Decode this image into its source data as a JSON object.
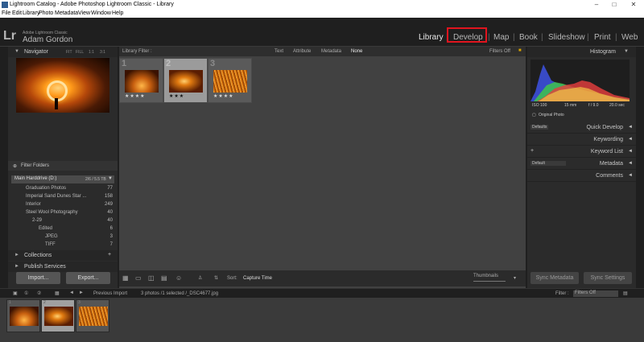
{
  "window": {
    "title": "Lightroom Catalog - Adobe Photoshop Lightroom Classic - Library",
    "minimize": "–",
    "restore": "□",
    "close": "✕"
  },
  "menu": [
    "File",
    "Edit",
    "Library",
    "Photo",
    "Metadata",
    "View",
    "Window",
    "Help"
  ],
  "identity": {
    "logo": "Lr",
    "product": "Adobe Lightroom Classic",
    "user": "Adam Gordon"
  },
  "modules": {
    "library": "Library",
    "develop": "Develop",
    "map": "Map",
    "book": "Book",
    "slideshow": "Slideshow",
    "print": "Print",
    "web": "Web",
    "sep": "|"
  },
  "navigator": {
    "title": "Navigator",
    "zoom": [
      "FIT",
      "FILL",
      "1:1",
      "3:1"
    ]
  },
  "folders": {
    "filter": "Filter Folders",
    "volume": {
      "name": "Main Harddrive (D:)",
      "size": "2/6 / 5.5 TB"
    },
    "items": [
      {
        "name": "Graduation Photos",
        "count": "77"
      },
      {
        "name": "Imperial Sand Dunes Star ...",
        "count": "158"
      },
      {
        "name": "Interior",
        "count": "249"
      },
      {
        "name": "Steel Wool Photography",
        "count": "40"
      },
      {
        "name": "2-29",
        "count": "40"
      },
      {
        "name": "Edited",
        "count": "6"
      },
      {
        "name": "JPEG",
        "count": "3"
      },
      {
        "name": "TIFF",
        "count": "7"
      }
    ]
  },
  "left_sections": {
    "collections": "Collections",
    "publish": "Publish Services",
    "plus": "+"
  },
  "left_buttons": {
    "import": "Import...",
    "export": "Export..."
  },
  "filter_bar": {
    "label": "Library Filter :",
    "text": "Text",
    "attribute": "Attribute",
    "metadata": "Metadata",
    "none": "None",
    "filters_off": "Filters Off"
  },
  "grid": [
    {
      "num": "1",
      "stars": "★★★★"
    },
    {
      "num": "2",
      "stars": "★★★"
    },
    {
      "num": "3",
      "stars": "★★★★"
    }
  ],
  "toolbar": {
    "sort_label": "Sort:",
    "sort_value": "Capture Time",
    "thumbnails": "Thumbnails"
  },
  "histogram": {
    "title": "Histogram",
    "iso": "ISO 100",
    "focal": "15 mm",
    "aperture": "f / 9.0",
    "shutter": "20.0 sec",
    "original": "Original Photo"
  },
  "right_panels": {
    "quick_develop": "Quick Develop",
    "keywording": "Keywording",
    "keyword_list": "Keyword List",
    "metadata": "Metadata",
    "comments": "Comments",
    "defaults": "Defaults",
    "default": "Default"
  },
  "right_buttons": {
    "sync_metadata": "Sync Metadata",
    "sync_settings": "Sync Settings"
  },
  "filmstrip_bar": {
    "source": "Previous Import",
    "summary": "3 photos /1 selected /_DSC4677.jpg",
    "filter_label": "Filter :",
    "filter_value": "Filters Off"
  },
  "filmstrip": [
    "1",
    "2",
    "3"
  ]
}
